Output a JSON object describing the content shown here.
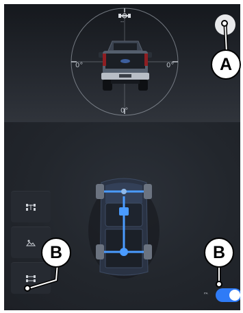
{
  "pitch_view": {
    "top_icon": "trailer-hitch-icon",
    "top_value": "--",
    "left_angle": "0°",
    "right_angle": "0°",
    "bottom_angle": "0°"
  },
  "close_button": {
    "label": "×"
  },
  "callouts": {
    "a": "A",
    "b_left": "B",
    "b_right": "B"
  },
  "side_buttons": [
    {
      "icon": "axle-lock-icon"
    },
    {
      "icon": "terrain-mode-icon"
    },
    {
      "icon": "drivetrain-icon"
    }
  ],
  "toggle": {
    "label": "ᴾᴬ",
    "state": "on"
  },
  "colors": {
    "accent": "#2f7bf6",
    "drivetrain": "#4a9bff",
    "background": "#20242b",
    "callout_line": "#000000"
  }
}
